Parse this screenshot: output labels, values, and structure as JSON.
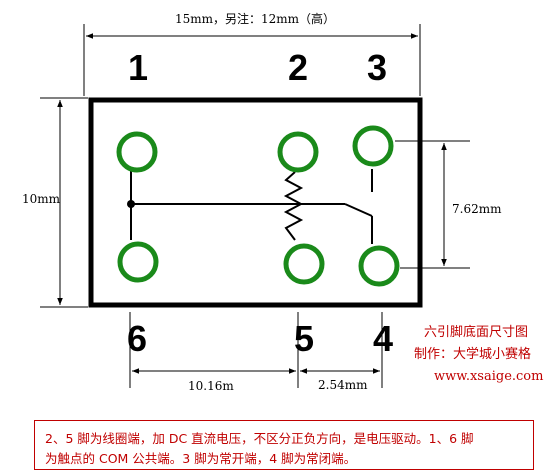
{
  "title_dim": "15mm，另注：12mm（高）",
  "height_dim": "10mm",
  "pitch_dim": "7.62mm",
  "pins": [
    {
      "number": "1"
    },
    {
      "number": "2"
    },
    {
      "number": "3"
    },
    {
      "number": "6"
    },
    {
      "number": "5"
    },
    {
      "number": "4"
    }
  ],
  "bottom_dims": {
    "left": "10.16m",
    "right": "2.54mm"
  },
  "side_caption": {
    "line1": "六引脚底面尺寸图",
    "line2": "制作：大学城小赛格",
    "line3": "www.xsaige.com"
  },
  "note": {
    "line1": "2、5 脚为线圈端，加 DC 直流电压，不区分正负方向，是电压驱动。1、6 脚",
    "line2": "为触点的 COM 公共端。3 脚为常开端，4 脚为常闭端。"
  },
  "colors": {
    "pad": "#1a8a1a",
    "caption": "#c00000"
  }
}
